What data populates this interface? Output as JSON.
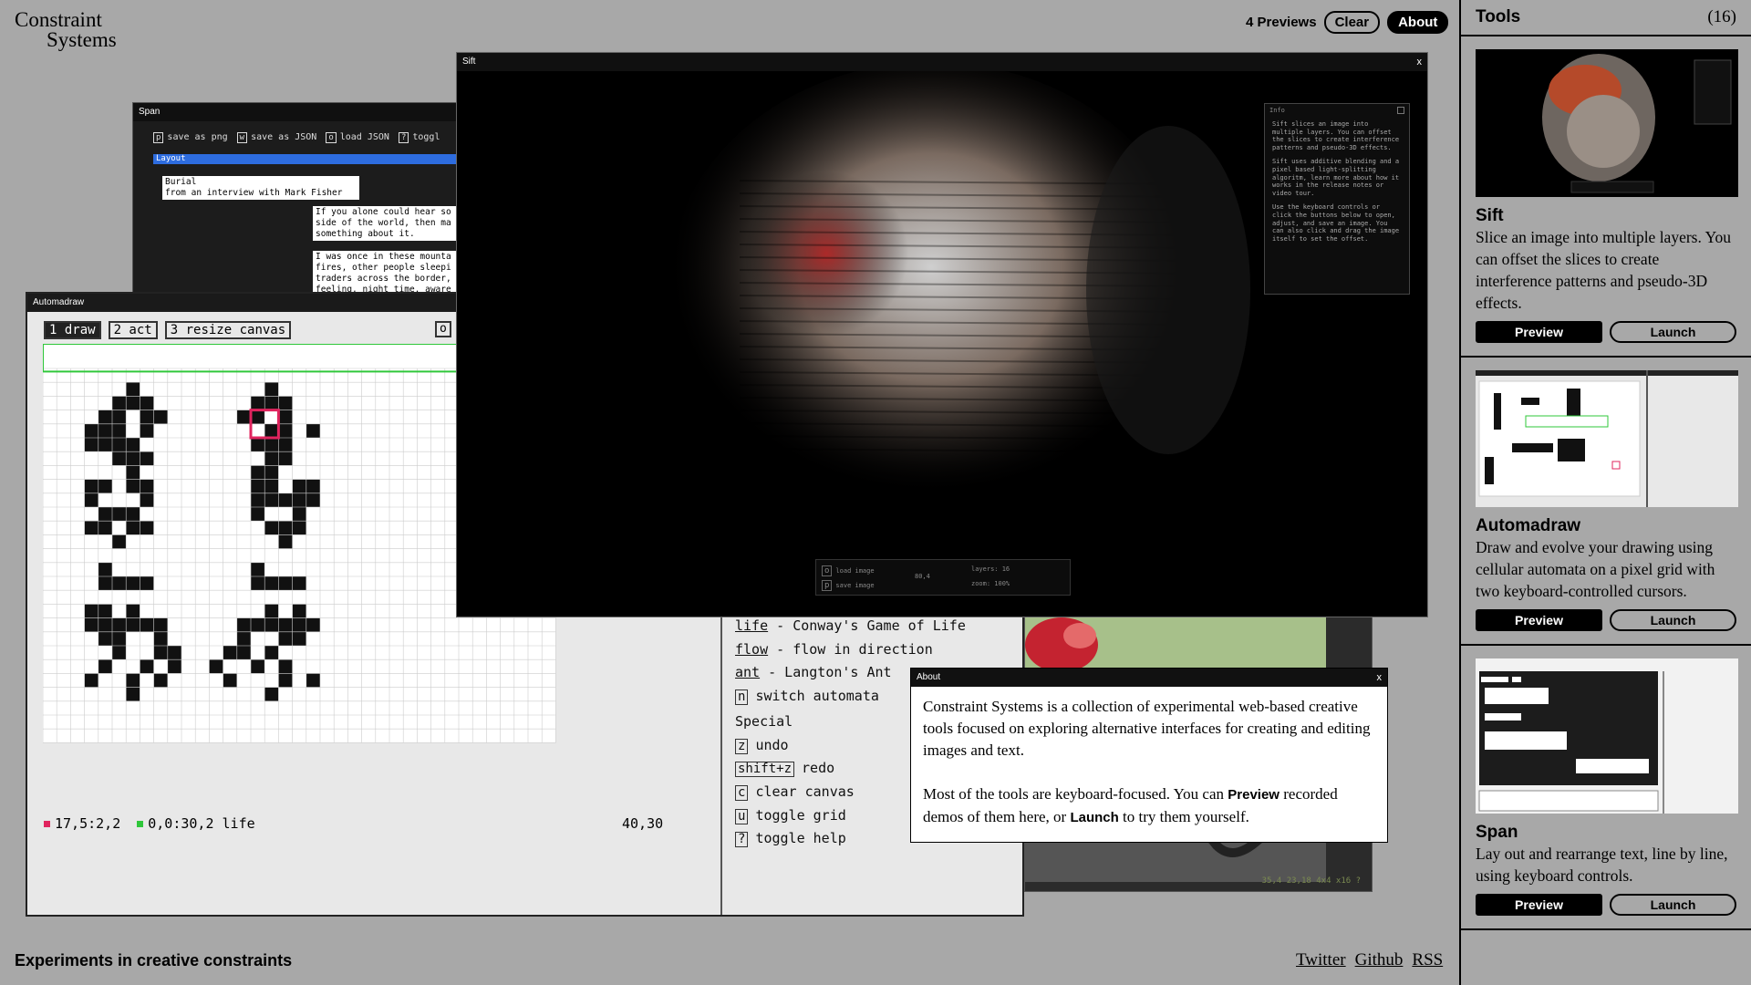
{
  "logo": {
    "line1": "Constraint",
    "line2": "Systems"
  },
  "topbar": {
    "previews": "4 Previews",
    "clear": "Clear",
    "about": "About"
  },
  "tagline": "Experiments in creative constraints",
  "footer": {
    "twitter": "Twitter",
    "github": "Github",
    "rss": "RSS"
  },
  "span_window": {
    "title": "Span",
    "tools": [
      {
        "key": "p",
        "label": "save as png"
      },
      {
        "key": "w",
        "label": "save as JSON"
      },
      {
        "key": "o",
        "label": "load JSON"
      },
      {
        "key": "?",
        "label": "toggl"
      }
    ],
    "layout_label": "Layout",
    "box1": "Burial\nfrom an interview with Mark Fisher",
    "box2": "If you alone could hear so\nside of the world, then ma\nsomething about it.",
    "box3": "I was once in these mounta\nfires, other people sleepi\ntraders across the border,\nfeeling, night time, aware"
  },
  "automadraw_window": {
    "title": "Automadraw",
    "tools": [
      "1 draw",
      "2 act",
      "3 resize canvas"
    ],
    "o_key": "o",
    "status_red": "17,5:2,2",
    "status_green": "0,0:30,2 life",
    "dimensions": "40,30",
    "colors": {
      "red": "#e0245e",
      "green": "#2fc73a"
    },
    "help": {
      "life": "life",
      "life_desc": " - Conway's Game of Life",
      "flow": "flow",
      "flow_desc": " - flow in direction",
      "ant": "ant",
      "ant_desc": " - Langton's Ant",
      "switch_key": "n",
      "switch_label": "switch automata",
      "special": "Special",
      "undo_key": "z",
      "undo": "undo",
      "redo_key": "shift+z",
      "redo": "redo",
      "clear_key": "c",
      "clear": "clear canvas",
      "grid_key": "u",
      "grid": "toggle grid",
      "help_key": "?",
      "help": "toggle help"
    }
  },
  "sift_window": {
    "title": "Sift",
    "close": "x",
    "info_title": "Info",
    "info_p1": "Sift slices an image into multiple layers. You can offset the slices to create interference patterns and pseudo-3D effects.",
    "info_p2": "Sift uses additive blending and a pixel based light-splitting algoritm, learn more about how it works in the release notes or video tour.",
    "info_p3": "Use the keyboard controls or click the buttons below to open, adjust, and save an image. You can also click and drag the image itself to set the offset.",
    "ctrl_load": "load image",
    "ctrl_save": "save image",
    "ctrl_offset": "80,4",
    "ctrl_layers": "layers: 16",
    "ctrl_zoom": "zoom: 100%"
  },
  "image_window": {
    "status": "35,4 23,18 4x4 x16  ?"
  },
  "about_window": {
    "title": "About",
    "close": "x",
    "p1": "Constraint Systems is a collection of experimental web-based creative tools focused on exploring alternative interfaces for creating and editing images and text.",
    "p2_a": "Most of the tools are keyboard-focused. You can ",
    "p2_preview": "Preview",
    "p2_b": " recorded demos of them here, or ",
    "p2_launch": "Launch",
    "p2_c": " to try them yourself."
  },
  "sidebar": {
    "title": "Tools",
    "count": "(16)",
    "tools": [
      {
        "name": "Sift",
        "desc": "Slice an image into multiple layers. You can offset the slices to create interference patterns and pseudo-3D effects.",
        "preview": "Preview",
        "launch": "Launch"
      },
      {
        "name": "Automadraw",
        "desc": "Draw and evolve your drawing using cellular automata on a pixel grid with two keyboard-controlled cursors.",
        "preview": "Preview",
        "launch": "Launch"
      },
      {
        "name": "Span",
        "desc": "Lay out and rearrange text, line by line, using keyboard controls.",
        "preview": "Preview",
        "launch": "Launch"
      }
    ]
  }
}
